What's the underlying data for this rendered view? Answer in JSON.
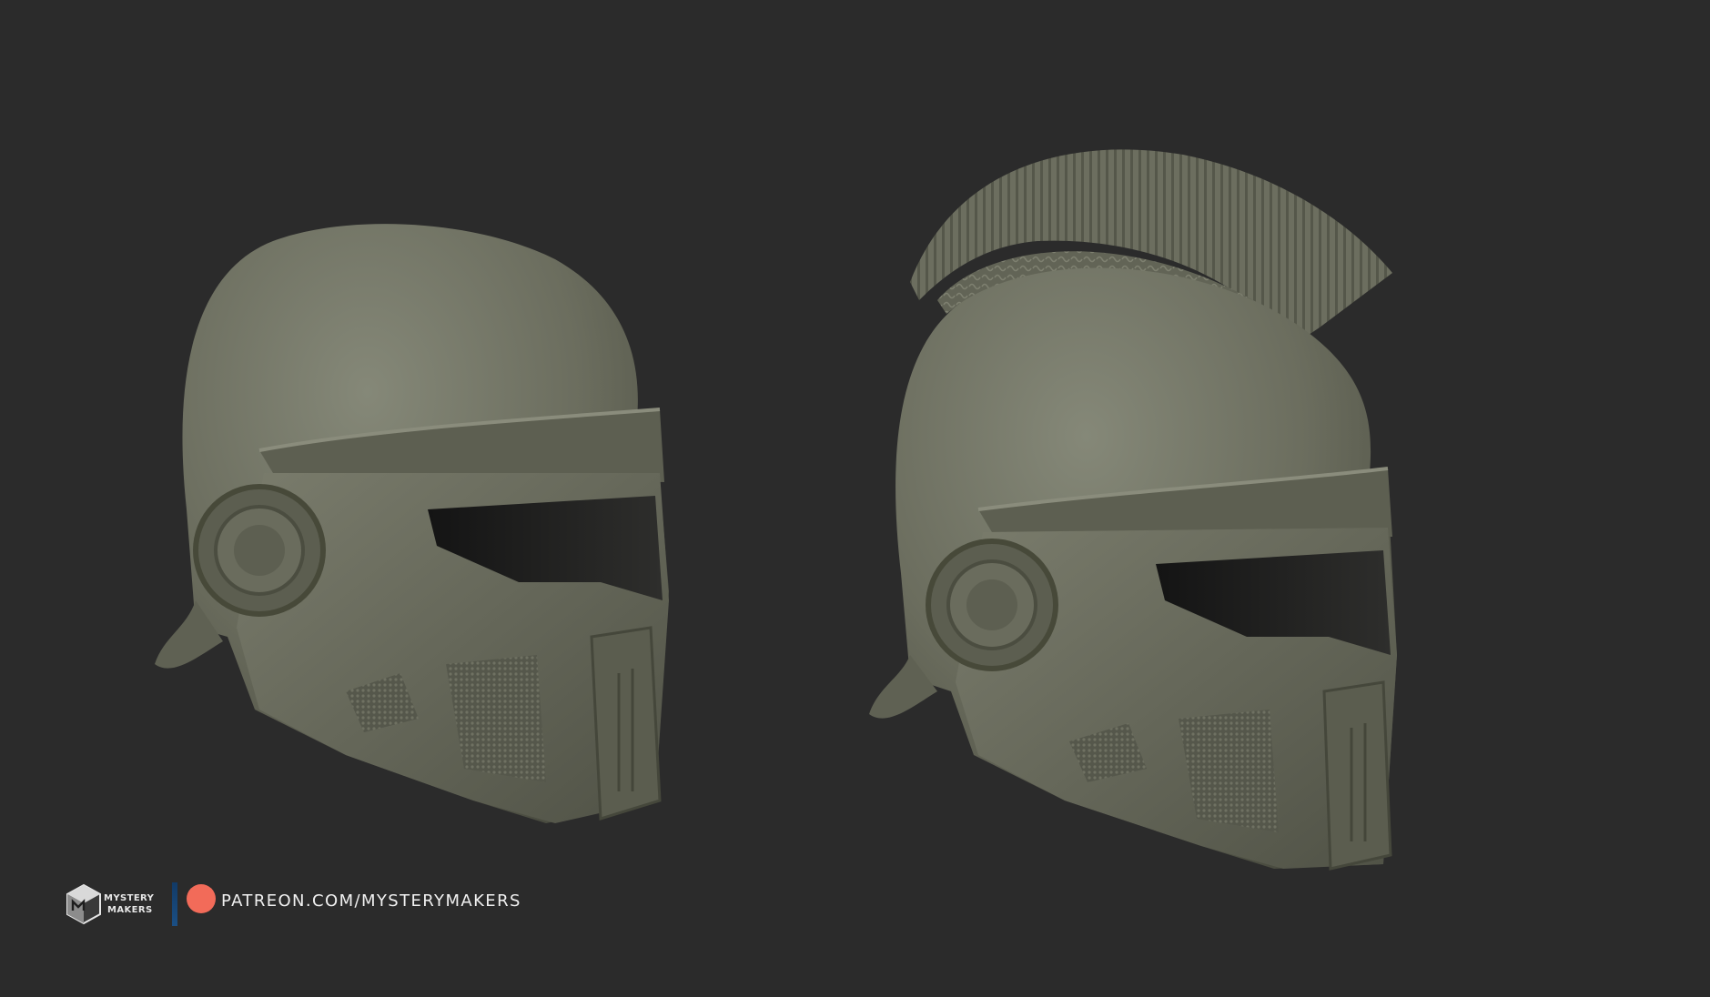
{
  "artwork": {
    "background_color": "#2b2b2b",
    "model_color": "#6d6f5f",
    "subjects": [
      "helmet-plain",
      "helmet-crested"
    ]
  },
  "footer": {
    "logo_text_line1": "MYSTERY",
    "logo_text_line2": "MAKERS",
    "patreon_url": "PATREON.COM/MYSTERYMAKERS",
    "patreon_dot_color": "#f26b59",
    "divider_color": "#16456f"
  }
}
